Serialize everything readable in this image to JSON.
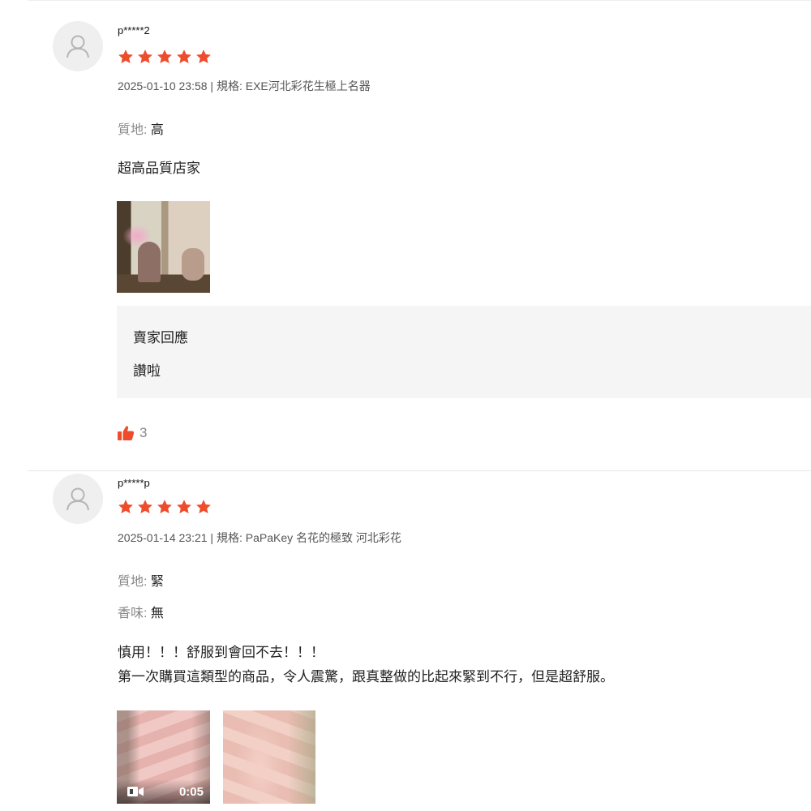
{
  "colors": {
    "star": "#ee4d2d",
    "like": "#ee4d2d",
    "reply_bg": "#f5f5f5"
  },
  "reviews": [
    {
      "username": "p*****2",
      "rating": 5,
      "meta": "2025-01-10 23:58 | 規格: EXE河北彩花生極上名器",
      "attributes": [
        {
          "key": "質地: ",
          "value": "高"
        }
      ],
      "comment": "超高品質店家",
      "media": [
        {
          "type": "photo"
        }
      ],
      "seller_reply": {
        "title": "賣家回應",
        "text": "讚啦"
      },
      "likes": "3"
    },
    {
      "username": "p*****p",
      "rating": 5,
      "meta": "2025-01-14 23:21 | 規格: PaPaKey 名花的極致 河北彩花",
      "attributes": [
        {
          "key": "質地: ",
          "value": "緊"
        },
        {
          "key": "香味: ",
          "value": "無"
        }
      ],
      "comment_lines": [
        "慎用！！！舒服到會回不去！！！",
        "第一次購買這類型的商品，令人震驚，跟真整做的比起來緊到不行，但是超舒服。"
      ],
      "media": [
        {
          "type": "video",
          "duration": "0:05"
        },
        {
          "type": "photo"
        }
      ]
    }
  ]
}
